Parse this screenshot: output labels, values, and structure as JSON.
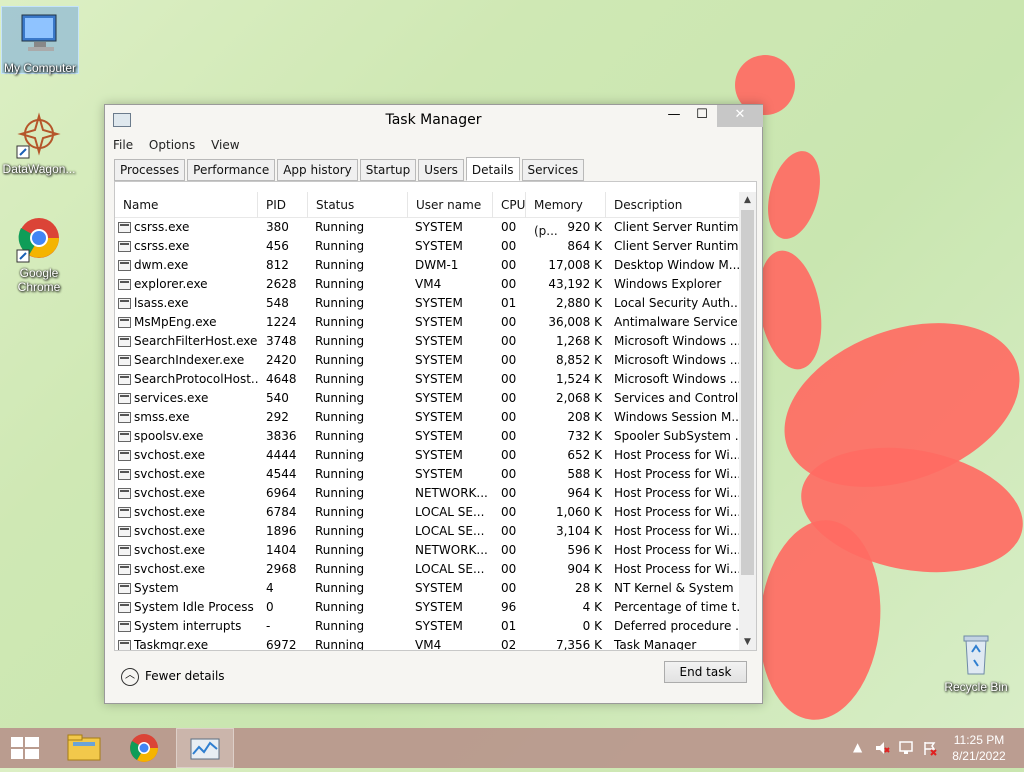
{
  "desktop": {
    "icons": [
      {
        "label": "My Computer"
      },
      {
        "label": "DataWagon..."
      },
      {
        "label": "Google Chrome"
      },
      {
        "label": "Recycle Bin"
      }
    ]
  },
  "window": {
    "title": "Task Manager",
    "controls": {
      "minimize": "—",
      "maximize": "☐",
      "close": "✕"
    },
    "menu": [
      "File",
      "Options",
      "View"
    ],
    "tabs": [
      "Processes",
      "Performance",
      "App history",
      "Startup",
      "Users",
      "Details",
      "Services"
    ],
    "active_tab": "Details",
    "columns": [
      "Name",
      "PID",
      "Status",
      "User name",
      "CPU",
      "Memory (p...",
      "Description"
    ],
    "rows": [
      [
        "csrss.exe",
        "380",
        "Running",
        "SYSTEM",
        "00",
        "920 K",
        "Client Server Runtim..."
      ],
      [
        "csrss.exe",
        "456",
        "Running",
        "SYSTEM",
        "00",
        "864 K",
        "Client Server Runtim..."
      ],
      [
        "dwm.exe",
        "812",
        "Running",
        "DWM-1",
        "00",
        "17,008 K",
        "Desktop Window M..."
      ],
      [
        "explorer.exe",
        "2628",
        "Running",
        "VM4",
        "00",
        "43,192 K",
        "Windows Explorer"
      ],
      [
        "lsass.exe",
        "548",
        "Running",
        "SYSTEM",
        "01",
        "2,880 K",
        "Local Security Auth..."
      ],
      [
        "MsMpEng.exe",
        "1224",
        "Running",
        "SYSTEM",
        "00",
        "36,008 K",
        "Antimalware Service..."
      ],
      [
        "SearchFilterHost.exe",
        "3748",
        "Running",
        "SYSTEM",
        "00",
        "1,268 K",
        "Microsoft Windows ..."
      ],
      [
        "SearchIndexer.exe",
        "2420",
        "Running",
        "SYSTEM",
        "00",
        "8,852 K",
        "Microsoft Windows ..."
      ],
      [
        "SearchProtocolHost....",
        "4648",
        "Running",
        "SYSTEM",
        "00",
        "1,524 K",
        "Microsoft Windows ..."
      ],
      [
        "services.exe",
        "540",
        "Running",
        "SYSTEM",
        "00",
        "2,068 K",
        "Services and Control..."
      ],
      [
        "smss.exe",
        "292",
        "Running",
        "SYSTEM",
        "00",
        "208 K",
        "Windows Session M..."
      ],
      [
        "spoolsv.exe",
        "3836",
        "Running",
        "SYSTEM",
        "00",
        "732 K",
        "Spooler SubSystem ..."
      ],
      [
        "svchost.exe",
        "4444",
        "Running",
        "SYSTEM",
        "00",
        "652 K",
        "Host Process for Wi..."
      ],
      [
        "svchost.exe",
        "4544",
        "Running",
        "SYSTEM",
        "00",
        "588 K",
        "Host Process for Wi..."
      ],
      [
        "svchost.exe",
        "6964",
        "Running",
        "NETWORK...",
        "00",
        "964 K",
        "Host Process for Wi..."
      ],
      [
        "svchost.exe",
        "6784",
        "Running",
        "LOCAL SE...",
        "00",
        "1,060 K",
        "Host Process for Wi..."
      ],
      [
        "svchost.exe",
        "1896",
        "Running",
        "LOCAL SE...",
        "00",
        "3,104 K",
        "Host Process for Wi..."
      ],
      [
        "svchost.exe",
        "1404",
        "Running",
        "NETWORK...",
        "00",
        "596 K",
        "Host Process for Wi..."
      ],
      [
        "svchost.exe",
        "2968",
        "Running",
        "LOCAL SE...",
        "00",
        "904 K",
        "Host Process for Wi..."
      ],
      [
        "System",
        "4",
        "Running",
        "SYSTEM",
        "00",
        "28 K",
        "NT Kernel & System"
      ],
      [
        "System Idle Process",
        "0",
        "Running",
        "SYSTEM",
        "96",
        "4 K",
        "Percentage of time t..."
      ],
      [
        "System interrupts",
        "-",
        "Running",
        "SYSTEM",
        "01",
        "0 K",
        "Deferred procedure ..."
      ],
      [
        "Taskmgr.exe",
        "6972",
        "Running",
        "VM4",
        "02",
        "7,356 K",
        "Task Manager"
      ]
    ],
    "fewer_details": "Fewer details",
    "end_task": "End task"
  },
  "taskbar": {
    "clock_time": "11:25 PM",
    "clock_date": "8/21/2022"
  },
  "colors": {
    "wallpaper": "#cfe8b4",
    "close_btn": "#c7c7c7",
    "taskbar": "#b9968c",
    "flower": "#ff6b63"
  }
}
